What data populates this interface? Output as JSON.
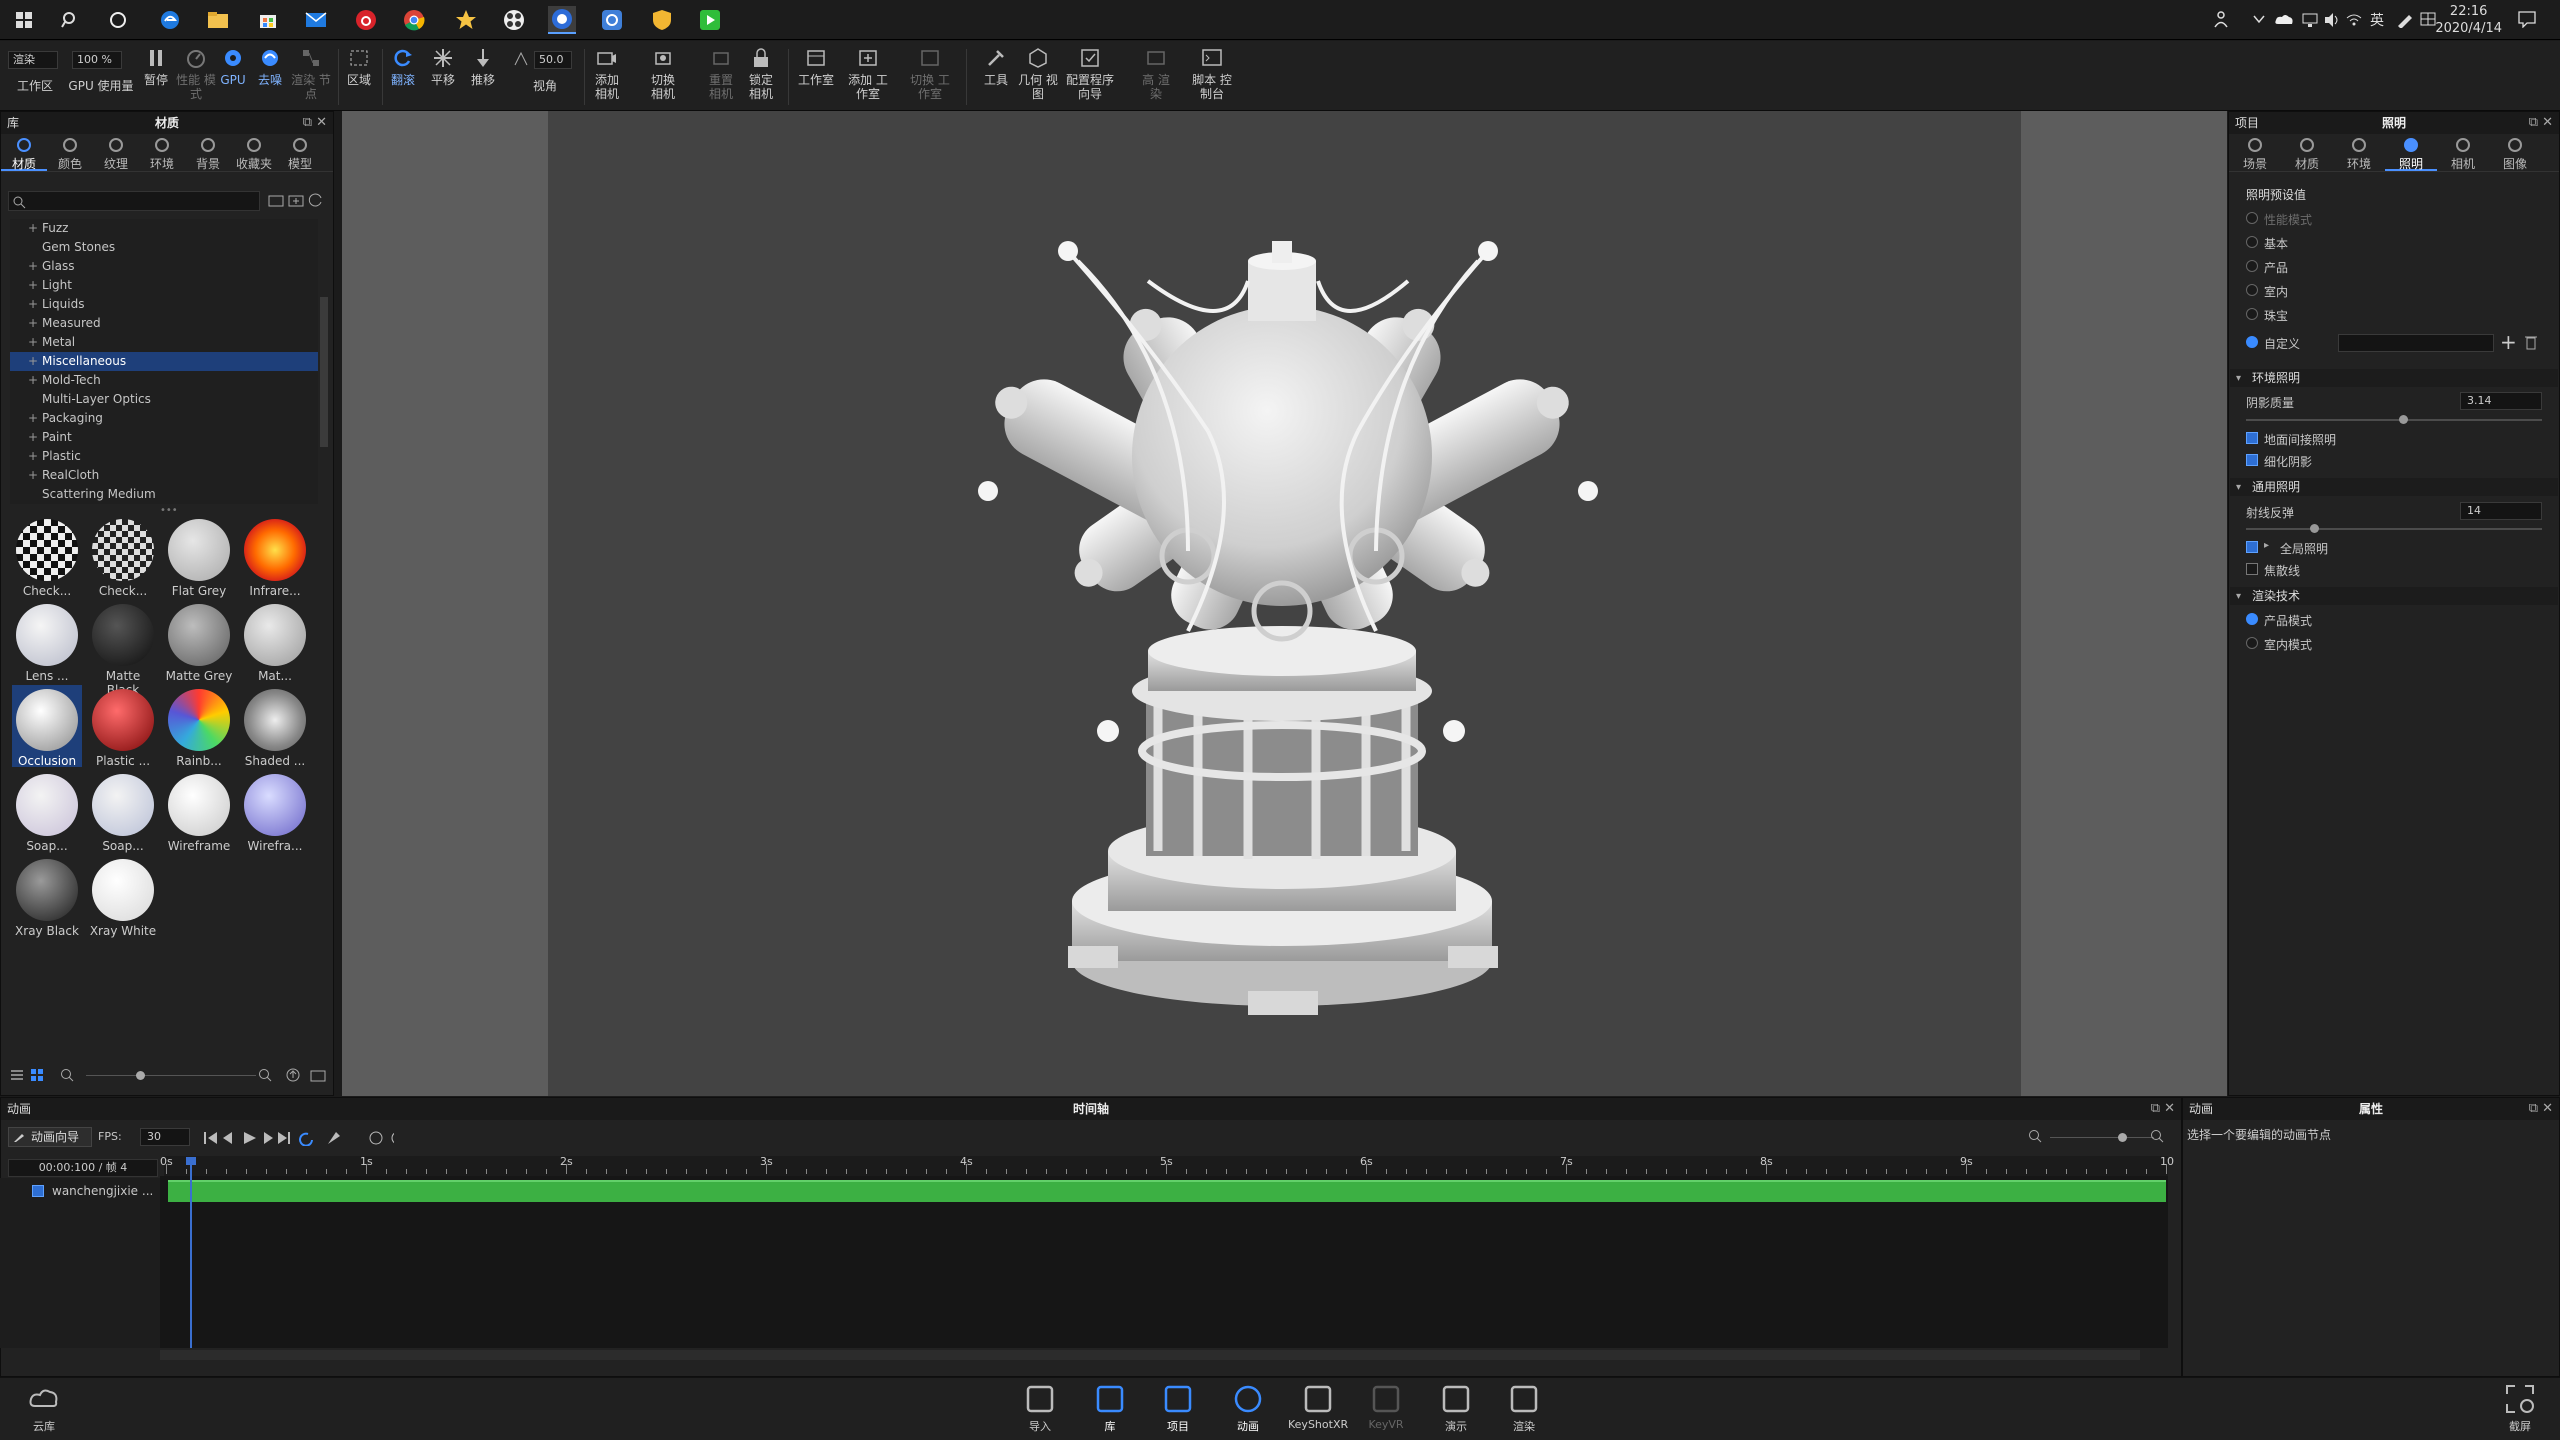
{
  "taskbar": {
    "clock_time": "22:16",
    "clock_date": "2020/4/14",
    "ime": "英"
  },
  "toolbar": {
    "mode_select": "渲染",
    "zoom_select": "100 %",
    "fov_value": "50.0",
    "items": [
      {
        "label": "工作区"
      },
      {
        "label": "GPU 使用量"
      },
      {
        "label": "暂停"
      },
      {
        "label": "性能 模式"
      },
      {
        "label": "GPU"
      },
      {
        "label": "去噪"
      },
      {
        "label": "渲染 节点"
      },
      {
        "label": "区域"
      },
      {
        "label": "翻滚"
      },
      {
        "label": "平移"
      },
      {
        "label": "推移"
      },
      {
        "label": "视角"
      },
      {
        "label": "添加 相机"
      },
      {
        "label": "切换 相机"
      },
      {
        "label": "重置 相机"
      },
      {
        "label": "锁定 相机"
      },
      {
        "label": "工作室"
      },
      {
        "label": "添加 工作室"
      },
      {
        "label": "切换 工作室"
      },
      {
        "label": "工具"
      },
      {
        "label": "几何 视图"
      },
      {
        "label": "配置程序 向导"
      },
      {
        "label": "高 渲染"
      },
      {
        "label": "脚本 控制台"
      }
    ]
  },
  "library": {
    "panel_left": "库",
    "panel_title": "材质",
    "tabs": [
      "材质",
      "颜色",
      "纹理",
      "环境",
      "背景",
      "收藏夹",
      "模型"
    ],
    "categories": [
      "Fuzz",
      "Gem Stones",
      "Glass",
      "Light",
      "Liquids",
      "Measured",
      "Metal",
      "Miscellaneous",
      "Mold-Tech",
      "Multi-Layer Optics",
      "Packaging",
      "Paint",
      "Plastic",
      "RealCloth",
      "Scattering Medium"
    ],
    "selected_category": "Miscellaneous",
    "thumbnails": [
      {
        "label": "Check..."
      },
      {
        "label": "Check..."
      },
      {
        "label": "Flat Grey"
      },
      {
        "label": "Infrare..."
      },
      {
        "label": "Lens ..."
      },
      {
        "label": "Matte Black"
      },
      {
        "label": "Matte Grey"
      },
      {
        "label": "Mat..."
      },
      {
        "label": "Occlusion"
      },
      {
        "label": "Plastic ..."
      },
      {
        "label": "Rainb..."
      },
      {
        "label": "Shaded ..."
      },
      {
        "label": "Soap..."
      },
      {
        "label": "Soap..."
      },
      {
        "label": "Wireframe"
      },
      {
        "label": "Wirefra..."
      },
      {
        "label": "Xray Black"
      },
      {
        "label": "Xray White"
      }
    ]
  },
  "project": {
    "panel_left": "项目",
    "panel_title": "照明",
    "tabs": [
      "场景",
      "材质",
      "环境",
      "照明",
      "相机",
      "图像"
    ],
    "presets_header": "照明预设值",
    "presets": [
      "性能模式",
      "基本",
      "产品",
      "室内",
      "珠宝",
      "自定义"
    ],
    "env_header": "环境照明",
    "shadow_quality_label": "阴影质量",
    "shadow_quality_value": "3.14",
    "ground_indirect": "地面间接照明",
    "fine_shadow": "细化阴影",
    "general_header": "通用照明",
    "ray_bounces_label": "射线反弹",
    "ray_bounces_value": "14",
    "global_illum": "全局照明",
    "caustics": "焦散线",
    "render_tech_header": "渲染技术",
    "product_mode": "产品模式",
    "interior_mode": "室内模式"
  },
  "animation": {
    "panel_left": "动画",
    "panel_title": "时间轴",
    "wizard_btn": "动画向导",
    "fps_label": "FPS:",
    "fps_value": "30",
    "time_display": "00:00:100 / 帧 4",
    "track_name": "wanchengjixie ...",
    "ruler_labels": [
      "0s",
      "1s",
      "2s",
      "3s",
      "4s",
      "5s",
      "6s",
      "7s",
      "8s",
      "9s",
      "10"
    ]
  },
  "properties": {
    "panel_left": "动画",
    "panel_title": "属性",
    "hint": "选择一个要编辑的动画节点"
  },
  "dock": {
    "left_label": "云库",
    "items": [
      "导入",
      "库",
      "项目",
      "动画",
      "KeyShotXR",
      "KeyVR",
      "演示",
      "渲染"
    ],
    "right_label": "截屏"
  },
  "colors": {
    "accent": "#3a8bff",
    "selection": "#1e3f7a",
    "timeline_bar": "#3cb043",
    "viewport_bg": "#434343"
  }
}
